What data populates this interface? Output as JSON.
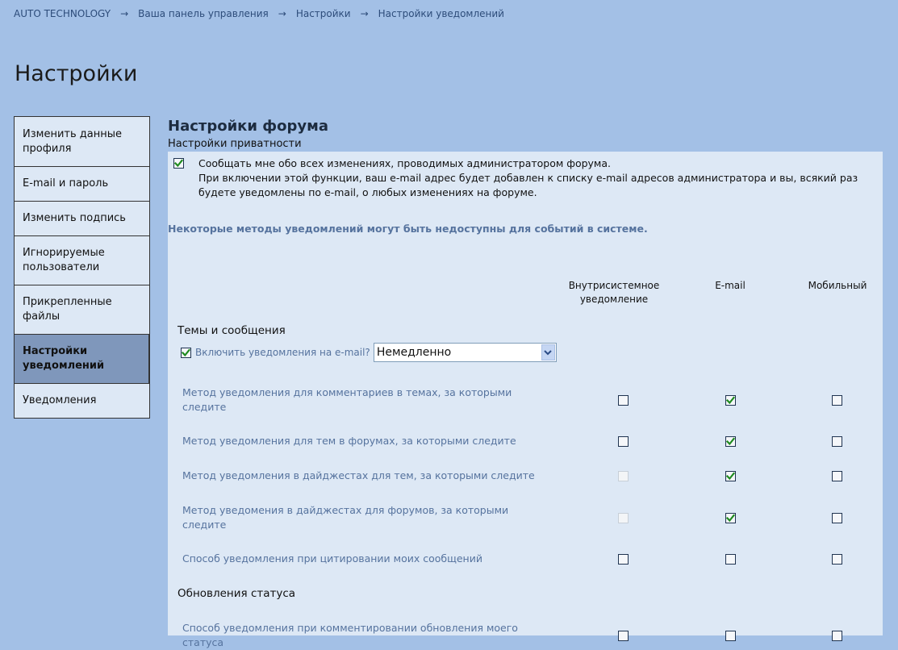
{
  "breadcrumb": {
    "items": [
      "AUTO TECHNOLOGY",
      "Ваша панель управления",
      "Настройки",
      "Настройки уведомлений"
    ],
    "separator": "→"
  },
  "page": {
    "title": "Настройки"
  },
  "sidebar": {
    "items": [
      {
        "label": "Изменить данные профиля",
        "active": false
      },
      {
        "label": "E-mail и пароль",
        "active": false
      },
      {
        "label": "Изменить подпись",
        "active": false
      },
      {
        "label": "Игнорируемые пользователи",
        "active": false
      },
      {
        "label": "Прикрепленные файлы",
        "active": false
      },
      {
        "label": "Настройки уведомлений",
        "active": true
      },
      {
        "label": "Уведомления",
        "active": false
      }
    ]
  },
  "main": {
    "title": "Настройки форума",
    "privacy_label": "Настройки приватности",
    "privacy_option": {
      "checked": true,
      "line1": "Сообщать мне обо всех изменениях, проводимых администратором форума.",
      "line2": "При включении этой функции, ваш e-mail адрес будет добавлен к списку e-mail адресов администратора и вы, всякий раз будете уведомлены по e-mail, о любых изменениях на форуме."
    },
    "note": "Некоторые методы уведомлений могут быть недоступны для событий в системе.",
    "columns": {
      "inapp": "Внутрисистемное уведомление",
      "email": "E-mail",
      "mobile": "Мобильный"
    },
    "groups": [
      {
        "title": "Темы и сообщения"
      },
      {
        "title": "Обновления статуса"
      }
    ],
    "email_toggle": {
      "checked": true,
      "label": "Включить уведомления на e-mail?",
      "selected": "Немедленно"
    },
    "rows": [
      {
        "label": "Метод уведомления для комментариев в темах, за которыми следите",
        "inapp": "unchecked",
        "email": "checked",
        "mobile": "unchecked"
      },
      {
        "label": "Метод уведомления для тем в форумах, за которыми следите",
        "inapp": "unchecked",
        "email": "checked",
        "mobile": "unchecked"
      },
      {
        "label": "Метод уведомления в дайджестах для тем, за которыми следите",
        "inapp": "disabled",
        "email": "checked",
        "mobile": "unchecked"
      },
      {
        "label": "Метод уведомения в дайджестах для форумов, за которыми следите",
        "inapp": "disabled",
        "email": "checked",
        "mobile": "unchecked"
      },
      {
        "label": "Способ уведомления при цитировании моих сообщений",
        "inapp": "unchecked",
        "email": "unchecked",
        "mobile": "unchecked"
      },
      {
        "label": "Способ уведомления при комментировании обновления моего статуса",
        "inapp": "unchecked",
        "email": "unchecked",
        "mobile": "unchecked"
      }
    ]
  }
}
